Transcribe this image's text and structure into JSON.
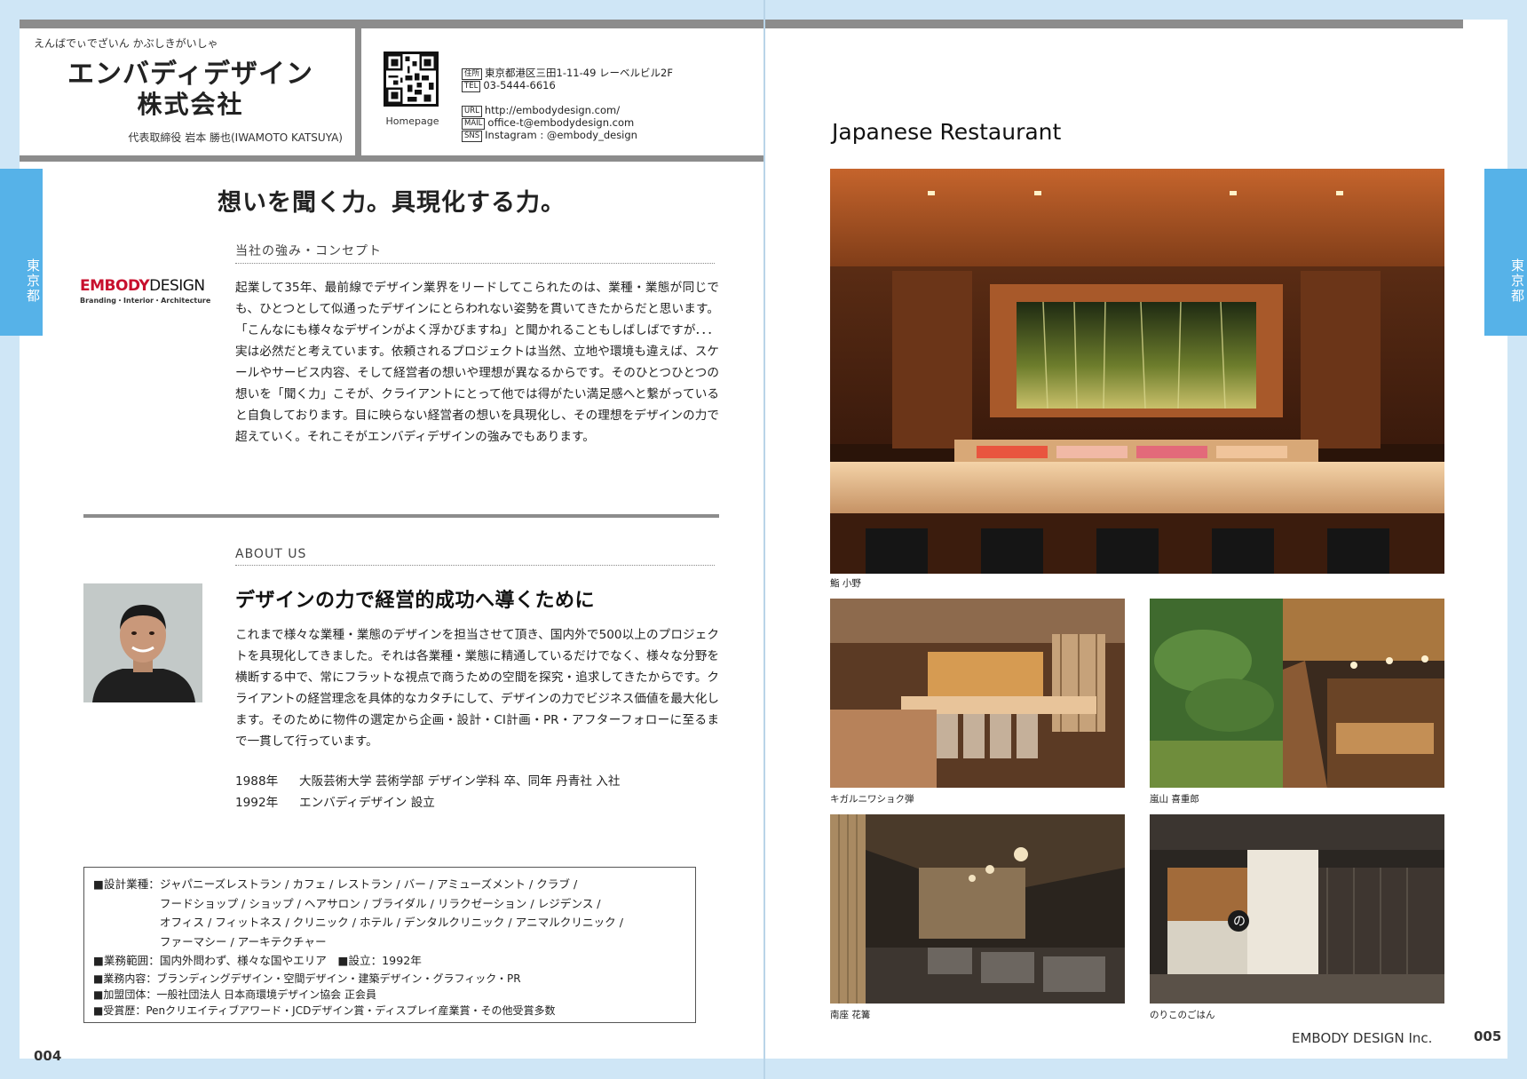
{
  "header": {
    "kana": "えんばでぃでざいん かぶしきがいしゃ",
    "company_line1": "エンバディデザイン",
    "company_line2": "株式会社",
    "representative": "代表取締役 岩本 勝也(IWAMOTO KATSUYA)",
    "qr_label": "Homepage",
    "contacts": [
      {
        "tag": "住所",
        "value": "東京都港区三田1-11-49 レーベルビル2F"
      },
      {
        "tag": "TEL",
        "value": "03-5444-6616"
      },
      {
        "tag": "URL",
        "value": "http://embodydesign.com/"
      },
      {
        "tag": "MAIL",
        "value": "office-t@embodydesign.com"
      },
      {
        "tag": "SNS",
        "value": "Instagram : @embody_design"
      }
    ]
  },
  "side_tab": "東京都",
  "headline": "想いを聞く力。具現化する力。",
  "concept": {
    "heading": "当社の強み・コンセプト",
    "logo_red": "EMBODY",
    "logo_black": "DESIGN",
    "logo_sub": "Branding・Interior・Architecture",
    "text": "起業して35年、最前線でデザイン業界をリードしてこられたのは、業種・業態が同じでも、ひとつとして似通ったデザインにとらわれない姿勢を貫いてきたからだと思います。「こんなにも様々なデザインがよく浮かびますね」と聞かれることもしばしばですが．．．実は必然だと考えています。依頼されるプロジェクトは当然、立地や環境も違えば、スケールやサービス内容、そして経営者の想いや理想が異なるからです。そのひとつひとつの想いを「聞く力」こそが、クライアントにとって他では得がたい満足感へと繋がっていると自負しております。目に映らない経営者の想いを具現化し、その理想をデザインの力で超えていく。それこそがエンバディデザインの強みでもあります。"
  },
  "about": {
    "heading": "ABOUT US",
    "subheading": "デザインの力で経営的成功へ導くために",
    "text": "これまで様々な業種・業態のデザインを担当させて頂き、国内外で500以上のプロジェクトを具現化してきました。それは各業種・業態に精通しているだけでなく、様々な分野を横断する中で、常にフラットな視点で商うための空間を探究・追求してきたからです。クライアントの経営理念を具体的なカタチにして、デザインの力でビジネス価値を最大化します。そのために物件の選定から企画・設計・CI計画・PR・アフターフォローに至るまで一貫して行っています。",
    "history": [
      {
        "year": "1988年",
        "event": "大阪芸術大学 芸術学部 デザイン学科 卒、同年 丹青社 入社"
      },
      {
        "year": "1992年",
        "event": "エンバディデザイン 設立"
      }
    ]
  },
  "info": {
    "design_label": "■設計業種：",
    "design_lines": [
      "ジャパニーズレストラン / カフェ / レストラン / バー / アミューズメント / クラブ /",
      "フードショップ / ショップ / ヘアサロン / ブライダル / リラクゼーション / レジデンス /",
      "オフィス / フィットネス / クリニック / ホテル / デンタルクリニック / アニマルクリニック /",
      "ファーマシー / アーキテクチャー"
    ],
    "scope": "■業務範囲：国内外問わず、様々な国やエリア　■設立：1992年",
    "services": "■業務内容：ブランディングデザイン・空間デザイン・建築デザイン・グラフィック・PR",
    "member": "■加盟団体：一般社団法人 日本商環境デザイン協会 正会員",
    "awards": "■受賞歴：Penクリエイティブアワード・JCDデザイン賞・ディスプレイ産業賞・その他受賞多数"
  },
  "page_numbers": {
    "left": "004",
    "right": "005"
  },
  "footer_company": "EMBODY DESIGN Inc.",
  "right_title": "Japanese Restaurant",
  "captions": {
    "main": "鮨 小野",
    "a": "キガルニワショク弾",
    "b": "嵐山 喜重郎",
    "c": "南座 花篝",
    "d": "のりこのごはん"
  }
}
